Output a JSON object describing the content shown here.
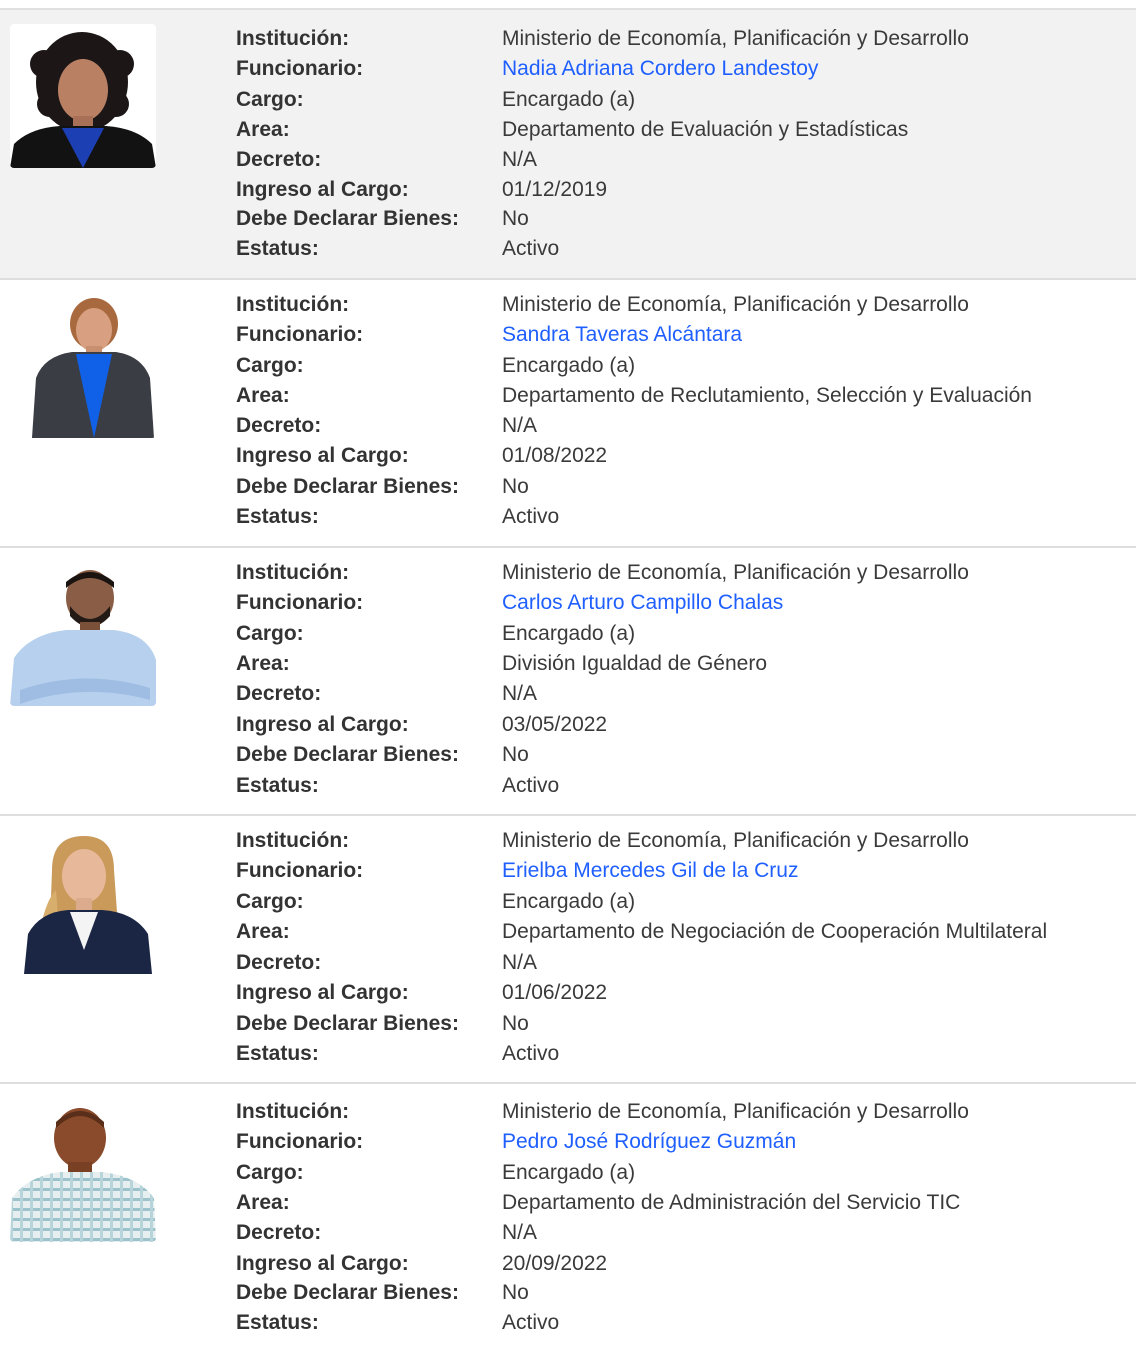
{
  "labels": {
    "institucion": "Institución:",
    "funcionario": "Funcionario:",
    "cargo": "Cargo:",
    "area": "Area:",
    "decreto": "Decreto:",
    "ingreso": "Ingreso al Cargo:",
    "bienes": "Debe Declarar Bienes:",
    "estatus": "Estatus:"
  },
  "colors": {
    "link": "#1f5fff",
    "shaded_row": "#f2f2f2"
  },
  "records": [
    {
      "photo_icon": "person-photo-woman-curly-hair",
      "institucion": "Ministerio de Economía, Planificación y Desarrollo",
      "funcionario": "Nadia Adriana Cordero Landestoy",
      "cargo": "Encargado (a)",
      "area": "Departamento de Evaluación y Estadísticas",
      "decreto": "N/A",
      "ingreso": "01/12/2019",
      "bienes": "No",
      "estatus": "Activo"
    },
    {
      "photo_icon": "person-photo-woman-blue-top",
      "institucion": "Ministerio de Economía, Planificación y Desarrollo",
      "funcionario": "Sandra Taveras Alcántara",
      "cargo": "Encargado (a)",
      "area": "Departamento de Reclutamiento, Selección y Evaluación",
      "decreto": "N/A",
      "ingreso": "01/08/2022",
      "bienes": "No",
      "estatus": "Activo"
    },
    {
      "photo_icon": "person-photo-man-light-blue-shirt",
      "institucion": "Ministerio de Economía, Planificación y Desarrollo",
      "funcionario": "Carlos Arturo Campillo Chalas",
      "cargo": "Encargado (a)",
      "area": "División Igualdad de Género",
      "decreto": "N/A",
      "ingreso": "03/05/2022",
      "bienes": "No",
      "estatus": "Activo"
    },
    {
      "photo_icon": "person-photo-woman-navy-blazer",
      "institucion": "Ministerio de Economía, Planificación y Desarrollo",
      "funcionario": "Erielba Mercedes Gil de la Cruz",
      "cargo": "Encargado (a)",
      "area": "Departamento de Negociación de Cooperación Multilateral",
      "decreto": "N/A",
      "ingreso": "01/06/2022",
      "bienes": "No",
      "estatus": "Activo"
    },
    {
      "photo_icon": "person-photo-man-plaid-shirt",
      "institucion": "Ministerio de Economía, Planificación y Desarrollo",
      "funcionario": "Pedro José Rodríguez Guzmán",
      "cargo": "Encargado (a)",
      "area": "Departamento de Administración del Servicio TIC",
      "decreto": "N/A",
      "ingreso": "20/09/2022",
      "bienes": "No",
      "estatus": "Activo"
    }
  ]
}
